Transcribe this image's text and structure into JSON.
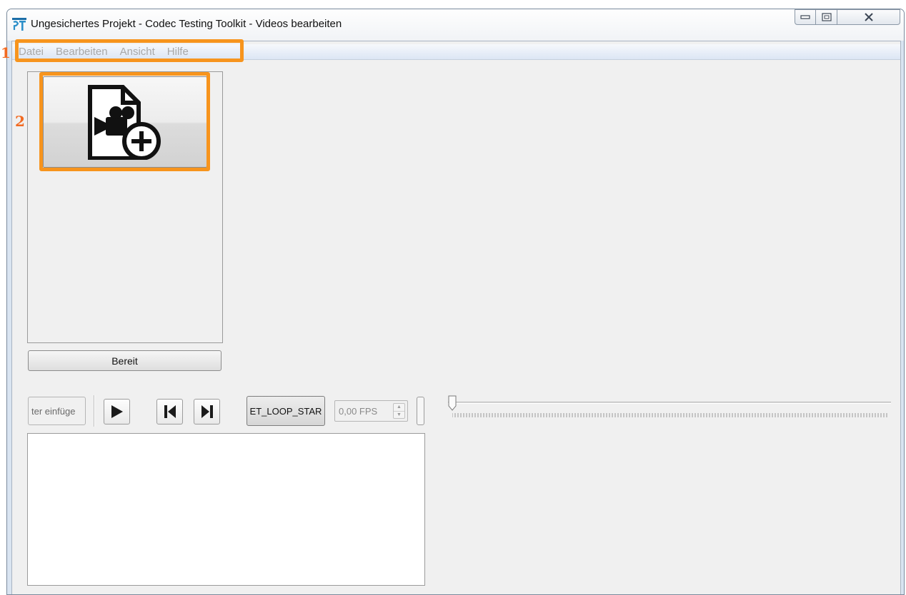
{
  "window": {
    "title": "Ungesichertes Projekt - Codec Testing Toolkit - Videos bearbeiten",
    "app_icon": "codec-toolkit-logo-icon",
    "controls": {
      "minimize_icon": "minimize-icon",
      "maximize_icon": "maximize-icon",
      "close_icon": "close-icon"
    }
  },
  "menubar": {
    "items": [
      {
        "label": "Datei"
      },
      {
        "label": "Bearbeiten"
      },
      {
        "label": "Ansicht"
      },
      {
        "label": "Hilfe"
      }
    ]
  },
  "left_panel": {
    "add_video_icon": "add-video-file-icon",
    "status_label": "Bereit"
  },
  "toolbar": {
    "insert_field_value": "ter einfüge",
    "play_icon": "play-icon",
    "skip_back_icon": "skip-to-start-icon",
    "skip_forward_icon": "skip-to-end-icon",
    "loop_label": "ET_LOOP_STAR",
    "fps_value": "0,00 FPS"
  },
  "timeline": {
    "position": 0
  },
  "annotations": {
    "menu_marker": "1",
    "add_button_marker": "2",
    "color": "#f7941d"
  }
}
